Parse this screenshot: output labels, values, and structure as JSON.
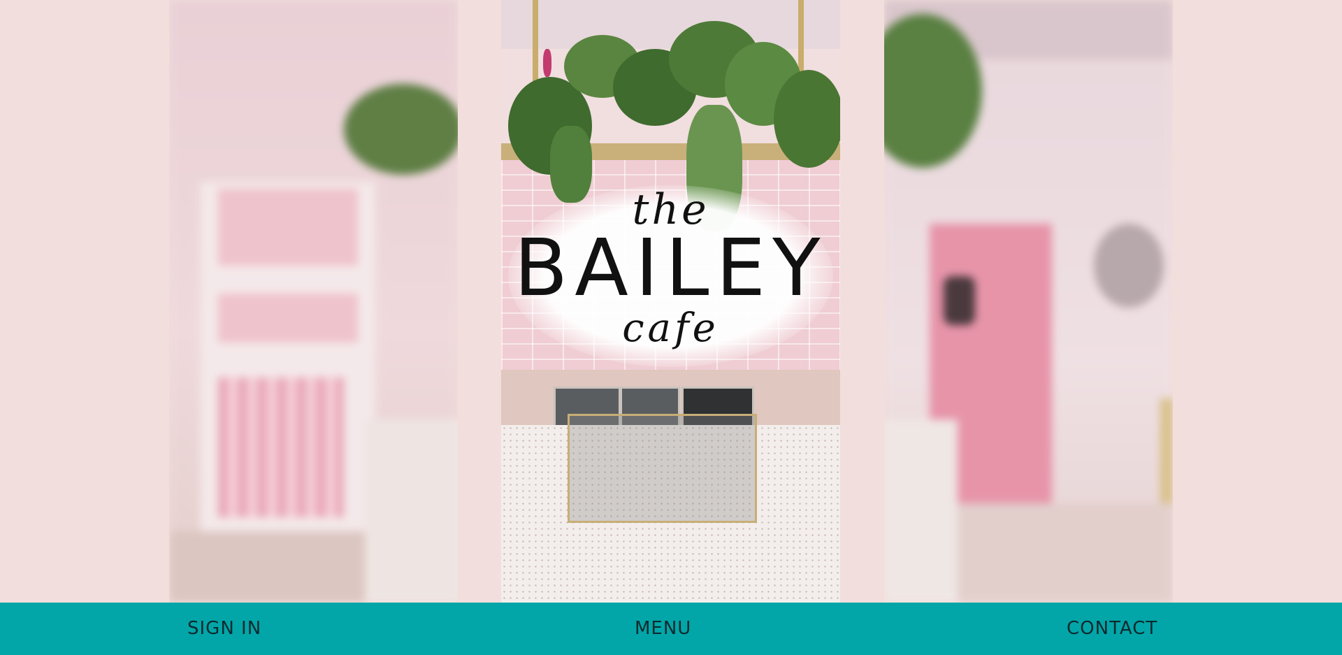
{
  "hero": {
    "logo": {
      "line1": "the",
      "line2": "BAILEY",
      "line3": "cafe"
    }
  },
  "nav": {
    "sign_in": "SIGN IN",
    "menu": "MENU",
    "contact": "CONTACT"
  },
  "colors": {
    "background": "#f2dedc",
    "nav_bar": "#02a6a8",
    "nav_text": "#0e2a2e"
  }
}
